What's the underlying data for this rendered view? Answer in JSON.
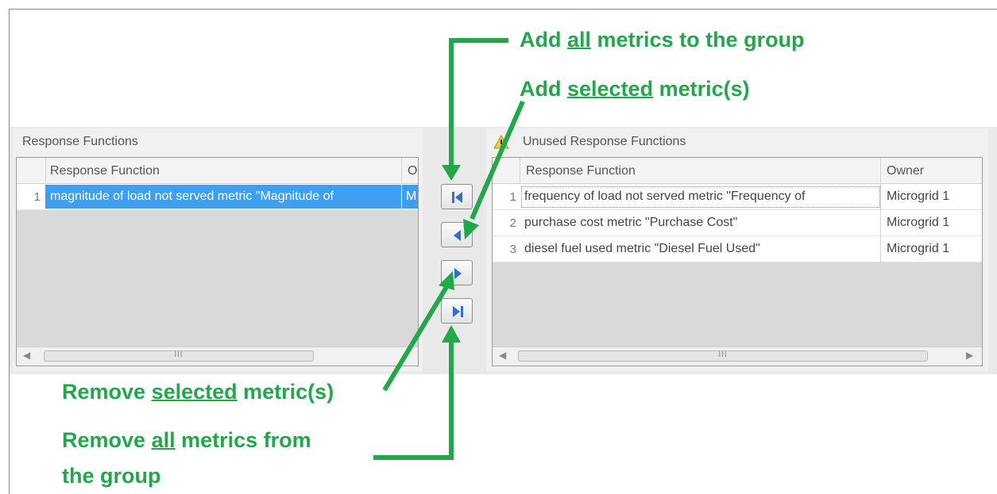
{
  "left_panel": {
    "title": "Response Functions",
    "col_function": "Response Function",
    "col_owner_partial": "O",
    "rows": [
      {
        "num": "1",
        "function": "magnitude of load not served metric \"Magnitude of",
        "owner": "M"
      }
    ]
  },
  "right_panel": {
    "title": "Unused Response Functions",
    "col_function": "Response Function",
    "col_owner": "Owner",
    "rows": [
      {
        "num": "1",
        "function": "frequency of load not served metric \"Frequency of",
        "owner": "Microgrid 1"
      },
      {
        "num": "2",
        "function": "purchase cost metric \"Purchase Cost\"",
        "owner": "Microgrid 1"
      },
      {
        "num": "3",
        "function": "diesel fuel used metric \"Diesel Fuel Used\"",
        "owner": "Microgrid 1"
      }
    ]
  },
  "scrollbar": {
    "grip": "III"
  },
  "annotations": {
    "add_all": {
      "pre": "Add ",
      "u": "all",
      "post": " metrics to the group"
    },
    "add_selected": {
      "pre": "Add ",
      "u": "selected",
      "post": " metric(s)"
    },
    "remove_selected": {
      "pre": "Remove ",
      "u": "selected",
      "post": " metric(s)"
    },
    "remove_all": {
      "pre": "Remove ",
      "u": "all",
      "post": " metrics from",
      "line2": "the group"
    }
  },
  "colors": {
    "annotation": "#22a84a",
    "selection": "#3e9ff0",
    "button_icon": "#2f6fd0"
  },
  "icons": [
    "warning-icon",
    "move-first-icon",
    "move-left-icon",
    "move-right-icon",
    "move-last-icon"
  ]
}
